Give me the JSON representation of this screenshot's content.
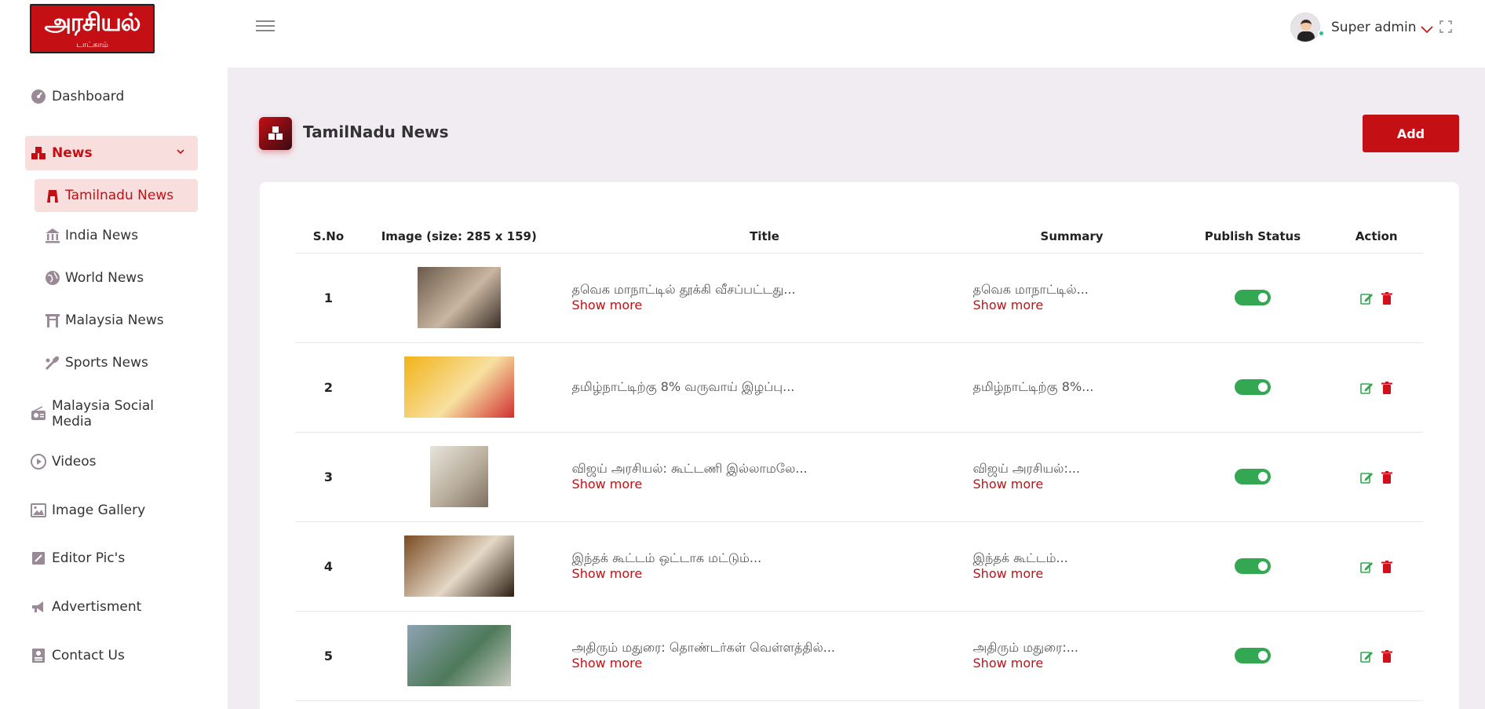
{
  "header": {
    "logo_text": "அரசியல்",
    "logo_sub": "டாட்காம்",
    "user_name": "Super admin"
  },
  "sidebar": {
    "items": [
      {
        "label": "Dashboard",
        "icon": "dashboard-icon"
      },
      {
        "label": "News",
        "icon": "news-icon",
        "active": true
      },
      {
        "label": "Malaysia Social Media",
        "icon": "radio-icon"
      },
      {
        "label": "Videos",
        "icon": "play-icon"
      },
      {
        "label": "Image Gallery",
        "icon": "image-icon"
      },
      {
        "label": "Editor Pic's",
        "icon": "edit-note-icon"
      },
      {
        "label": "Advertisment",
        "icon": "megaphone-icon"
      },
      {
        "label": "Contact Us",
        "icon": "contact-card-icon"
      }
    ],
    "news_sub": [
      {
        "label": "Tamilnadu News",
        "icon": "temple-icon",
        "active": true
      },
      {
        "label": "India News",
        "icon": "bank-icon"
      },
      {
        "label": "World News",
        "icon": "globe-icon"
      },
      {
        "label": "Malaysia News",
        "icon": "gate-icon"
      },
      {
        "label": "Sports News",
        "icon": "sports-icon"
      }
    ]
  },
  "page": {
    "title": "TamilNadu News",
    "add_label": "Add"
  },
  "table": {
    "headers": [
      "S.No",
      "Image (size: 285 x 159)",
      "Title",
      "Summary",
      "Publish Status",
      "Action"
    ],
    "show_more": "Show more",
    "rows": [
      {
        "sno": "1",
        "title": "தவெக மாநாட்டில் தூக்கி வீசப்பட்டது...",
        "summary": "தவெக மாநாட்டில்...",
        "published": true,
        "title_more": true,
        "summary_more": true,
        "thumb_w": 106,
        "thumb_colors": [
          "#6b5a4c",
          "#c9b6a0",
          "#3a2e28"
        ]
      },
      {
        "sno": "2",
        "title": "தமிழ்நாட்டிற்கு 8% வருவாய் இழப்பு...",
        "summary": "தமிழ்நாட்டிற்கு 8%...",
        "published": true,
        "title_more": false,
        "summary_more": false,
        "thumb_w": 140,
        "thumb_colors": [
          "#f2b318",
          "#f7e0a0",
          "#d03030"
        ]
      },
      {
        "sno": "3",
        "title": "விஜய் அரசியல்: கூட்டணி இல்லாமலே...",
        "summary": "விஜய் அரசியல்:...",
        "published": true,
        "title_more": true,
        "summary_more": true,
        "thumb_w": 74,
        "thumb_colors": [
          "#e8e4dc",
          "#b9ae9c",
          "#7d6f60"
        ]
      },
      {
        "sno": "4",
        "title": "இந்தக் கூட்டம் ஒட்டாக மட்டும்...",
        "summary": "இந்தக் கூட்டம்...",
        "published": true,
        "title_more": true,
        "summary_more": true,
        "thumb_w": 140,
        "thumb_colors": [
          "#7a4b22",
          "#e4d8c6",
          "#2d1e12"
        ]
      },
      {
        "sno": "5",
        "title": "அதிரும் மதுரை: தொண்டர்கள் வெள்ளத்தில்...",
        "summary": "அதிரும் மதுரை:...",
        "published": true,
        "title_more": true,
        "summary_more": true,
        "thumb_w": 132,
        "thumb_colors": [
          "#8ea3b3",
          "#4e7a5a",
          "#c9c9c0"
        ]
      }
    ]
  }
}
